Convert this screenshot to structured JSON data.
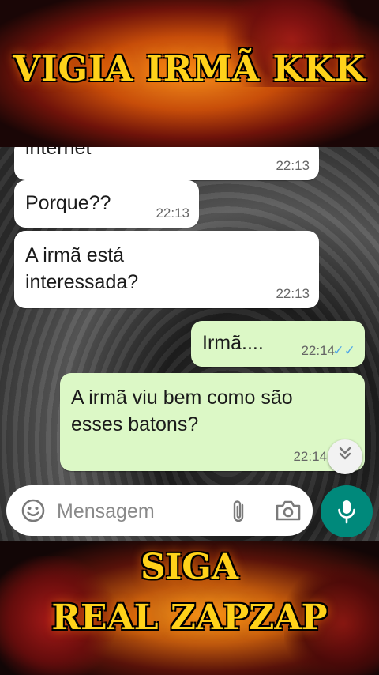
{
  "banner_top": {
    "title": "VIGIA IRMÃ KKK"
  },
  "messages": [
    {
      "text": "internet",
      "time": "22:13"
    },
    {
      "text": "Porque??",
      "time": "22:13"
    },
    {
      "text": "A irmã está interessada?",
      "time": "22:13"
    },
    {
      "text": "Irmã....",
      "time": "22:14",
      "ticks": "✓✓"
    },
    {
      "text": "A irmã viu bem como são esses batons?",
      "time": "22:14"
    }
  ],
  "composer": {
    "placeholder": "Mensagem"
  },
  "banner_bottom": {
    "line1": "SIGA",
    "line2": "REAL ZAPZAP"
  },
  "colors": {
    "outgoing_bubble": "#dcf8c6",
    "incoming_bubble": "#ffffff",
    "mic_button": "#00897b",
    "banner_text": "#ffd21a"
  },
  "icons": [
    "emoji-icon",
    "paperclip-icon",
    "camera-icon",
    "mic-icon",
    "double-chevron-down-icon"
  ]
}
